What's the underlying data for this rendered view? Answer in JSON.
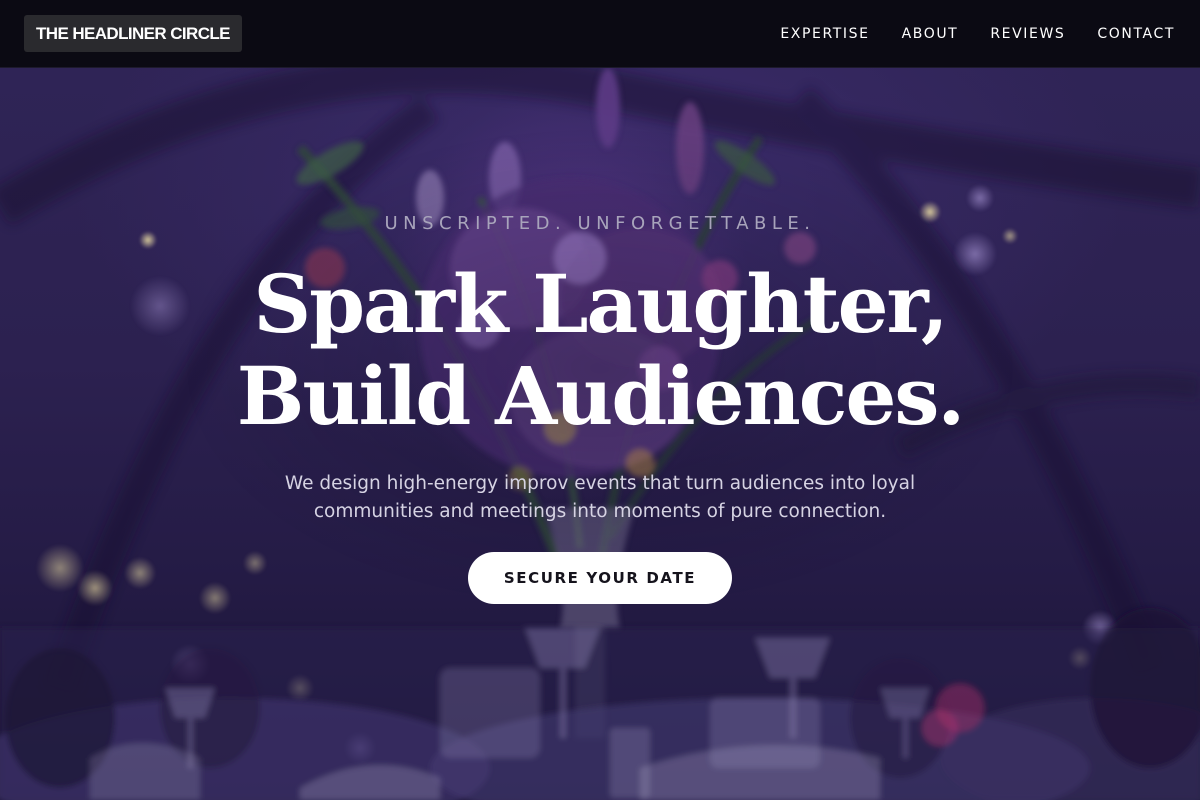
{
  "brand": {
    "name": "THE HEADLINER CIRCLE"
  },
  "nav": {
    "items": [
      {
        "label": "EXPERTISE"
      },
      {
        "label": "ABOUT"
      },
      {
        "label": "REVIEWS"
      },
      {
        "label": "CONTACT"
      }
    ]
  },
  "hero": {
    "tagline": "UNSCRIPTED. UNFORGETTABLE.",
    "headline_line1": "Spark Laughter,",
    "headline_line2": "Build Audiences.",
    "description": "We design high-energy improv events that turn audiences into loyal communities and meetings into moments of pure connection.",
    "cta_label": "SECURE YOUR DATE"
  },
  "colors": {
    "header_bg": "#0b0a13",
    "logo_bg": "#2a2a2e",
    "hero_bg": "#2c2150",
    "cta_bg": "#ffffff",
    "cta_text": "#15131c"
  }
}
